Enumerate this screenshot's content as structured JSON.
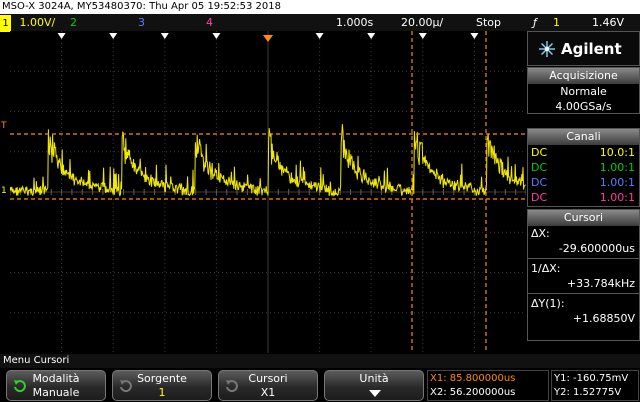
{
  "title": "MSO-X 3024A, MY53480370: Thu Apr 05 19:52:53 2018",
  "channels": [
    {
      "num": "1",
      "scale": "1.00V/",
      "color": "#ffff00"
    },
    {
      "num": "2",
      "color": "#00d000"
    },
    {
      "num": "3",
      "color": "#5a7dff"
    },
    {
      "num": "4",
      "color": "#ff3fa0"
    }
  ],
  "timebase": {
    "delay": "1.000s",
    "per_div": "20.00µ/",
    "status": "Stop"
  },
  "trigger": {
    "edge_symbol": "ƒ",
    "source": "1",
    "level": "1.46V"
  },
  "panel": {
    "brand": "Agilent",
    "acq": {
      "header": "Acquisizione",
      "mode": "Normale",
      "rate": "4.00GSa/s"
    },
    "channels": {
      "header": "Canali",
      "rows": [
        {
          "coupling": "DC",
          "probe": "10.0:1",
          "color": "#ffff00"
        },
        {
          "coupling": "DC",
          "probe": "1.00:1",
          "color": "#00d000"
        },
        {
          "coupling": "DC",
          "probe": "1.00:1",
          "color": "#5a7dff"
        },
        {
          "coupling": "DC",
          "probe": "1.00:1",
          "color": "#ff3fa0"
        }
      ]
    },
    "cursors": {
      "header": "Cursori",
      "dx_label": "ΔX:",
      "dx_value": "-29.600000us",
      "inv_label": "1/ΔX:",
      "inv_value": "+33.784kHz",
      "dy_label": "ΔY(1):",
      "dy_value": "+1.68850V"
    }
  },
  "menu": {
    "title": "Menu Cursori",
    "buttons": [
      {
        "line1": "Modalità",
        "line2": "Manuale"
      },
      {
        "line1": "Sorgente",
        "line2": "1"
      },
      {
        "line1": "Cursori",
        "line2": "X1"
      },
      {
        "line1": "Unità",
        "line2": ""
      }
    ],
    "readout": {
      "x1": "X1: 85.800000us",
      "x2": "X2: 56.200000us",
      "y1": "Y1: -160.75mV",
      "y2": "Y2: 1.52775V"
    }
  },
  "markers": {
    "trigger": "T",
    "ch1": "1"
  }
}
